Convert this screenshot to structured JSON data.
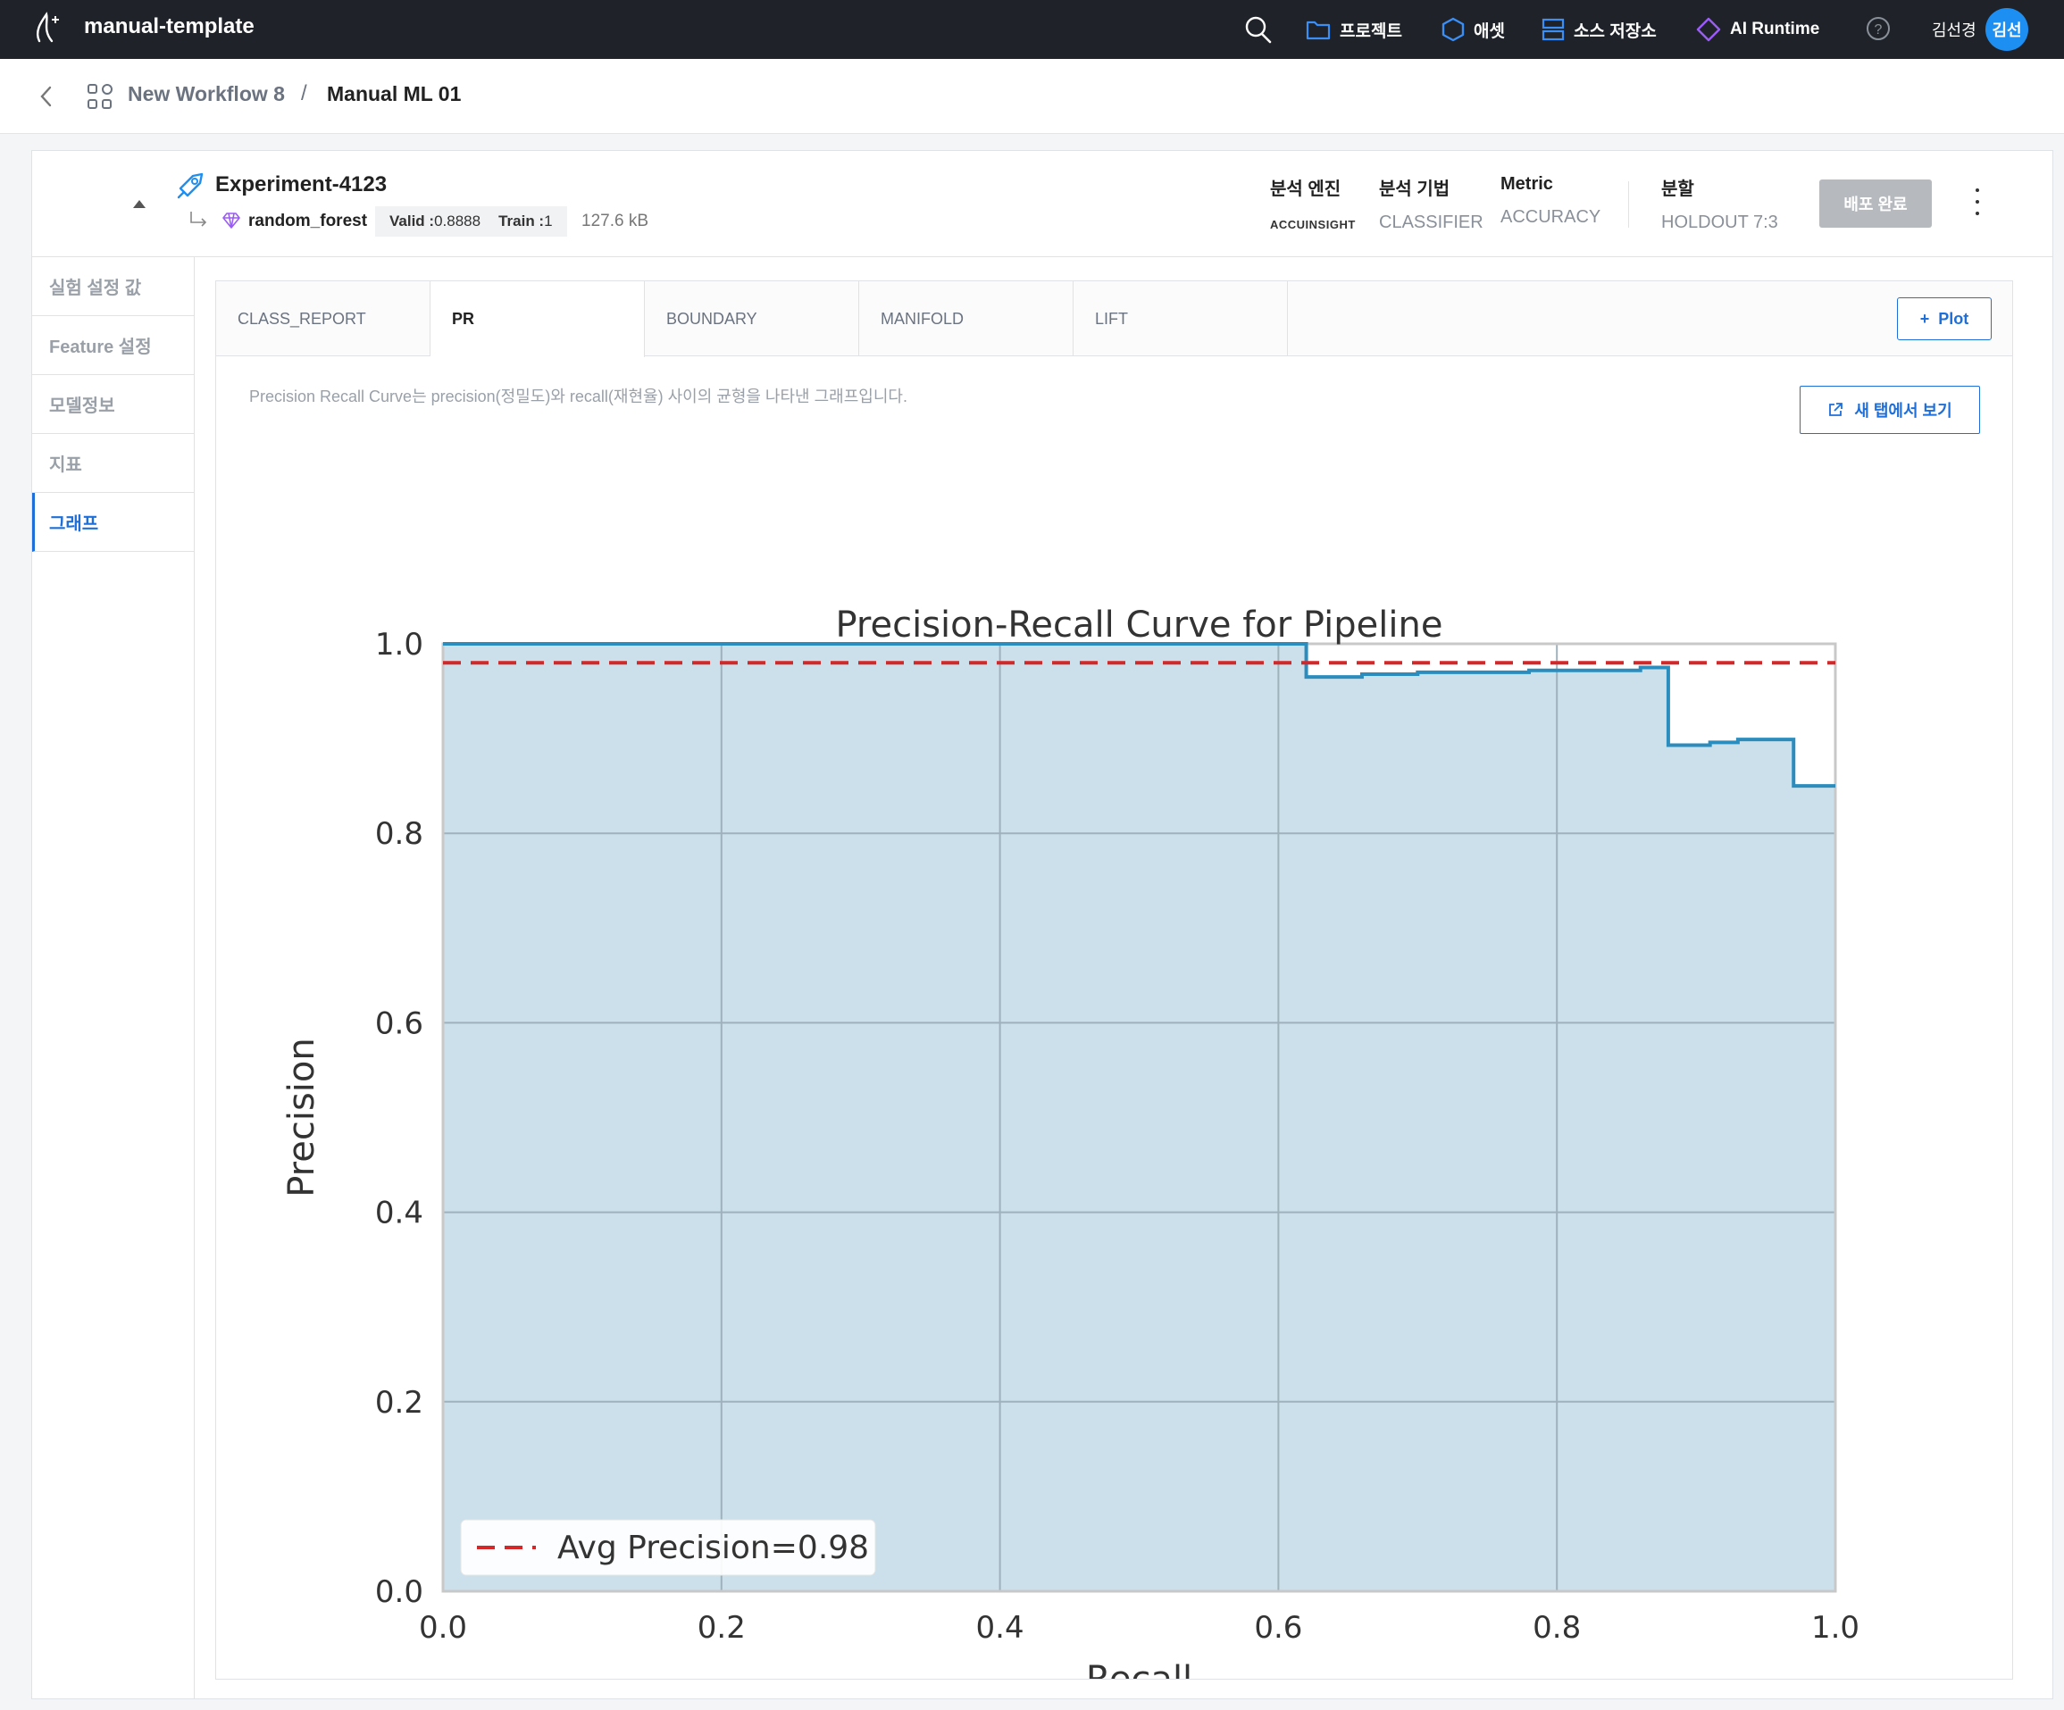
{
  "app": {
    "title": "manual-template"
  },
  "topnav": {
    "project": "프로젝트",
    "asset": "애셋",
    "source": "소스 저장소",
    "runtime": "AI Runtime",
    "user_name": "김선경",
    "avatar_text": "김선"
  },
  "breadcrumb": {
    "workflow": "New Workflow 8",
    "separator": "/",
    "current": "Manual ML 01"
  },
  "experiment": {
    "name": "Experiment-4123",
    "model": "random_forest",
    "valid_label": "Valid :",
    "valid_value": "0.8888",
    "train_label": "Train :",
    "train_value": "1",
    "size": "127.6 kB",
    "engine_label": "분석 엔진",
    "engine_value": "ACCUINSIGHT",
    "method_label": "분석 기법",
    "method_value": "CLASSIFIER",
    "metric_label": "Metric",
    "metric_value": "ACCURACY",
    "split_label": "분할",
    "split_value": "HOLDOUT 7:3",
    "deploy_button": "배포 완료"
  },
  "sidebar": {
    "items": [
      {
        "label": "실험 설정 값"
      },
      {
        "label": "Feature 설정"
      },
      {
        "label": "모델정보"
      },
      {
        "label": "지표"
      },
      {
        "label": "그래프"
      }
    ]
  },
  "tabs": [
    {
      "label": "CLASS_REPORT"
    },
    {
      "label": "PR"
    },
    {
      "label": "BOUNDARY"
    },
    {
      "label": "MANIFOLD"
    },
    {
      "label": "LIFT"
    }
  ],
  "plot_button": "Plot",
  "description": "Precision Recall Curve는 precision(정밀도)와 recall(재현율) 사이의 균형을 나타낸 그래프입니다.",
  "newtab_button": "새 탭에서 보기",
  "colors": {
    "accent": "#1e6fd9",
    "topbar": "#1f2329",
    "fill": "#cbe0eb",
    "curve": "#2b8cbe",
    "avg_line": "#d62728"
  },
  "chart_data": {
    "type": "area",
    "title": "Precision-Recall Curve for Pipeline",
    "xlabel": "Recall",
    "ylabel": "Precision",
    "xlim": [
      0.0,
      1.0
    ],
    "ylim": [
      0.0,
      1.0
    ],
    "xticks": [
      "0.0",
      "0.2",
      "0.4",
      "0.6",
      "0.8",
      "1.0"
    ],
    "yticks": [
      "0.0",
      "0.2",
      "0.4",
      "0.6",
      "0.8",
      "1.0"
    ],
    "grid": true,
    "legend_position": "lower-left",
    "series": [
      {
        "name": "",
        "style": "step",
        "x": [
          0.0,
          0.62,
          0.62,
          0.66,
          0.66,
          0.7,
          0.7,
          0.78,
          0.78,
          0.86,
          0.86,
          0.88,
          0.88,
          0.91,
          0.91,
          0.93,
          0.93,
          0.97,
          0.97,
          1.0
        ],
        "y": [
          1.0,
          1.0,
          0.965,
          0.965,
          0.968,
          0.968,
          0.97,
          0.97,
          0.972,
          0.972,
          0.975,
          0.975,
          0.893,
          0.893,
          0.896,
          0.896,
          0.899,
          0.899,
          0.85,
          0.85
        ]
      }
    ],
    "avg_precision": {
      "label": "Avg Precision=0.98",
      "value": 0.98
    }
  }
}
